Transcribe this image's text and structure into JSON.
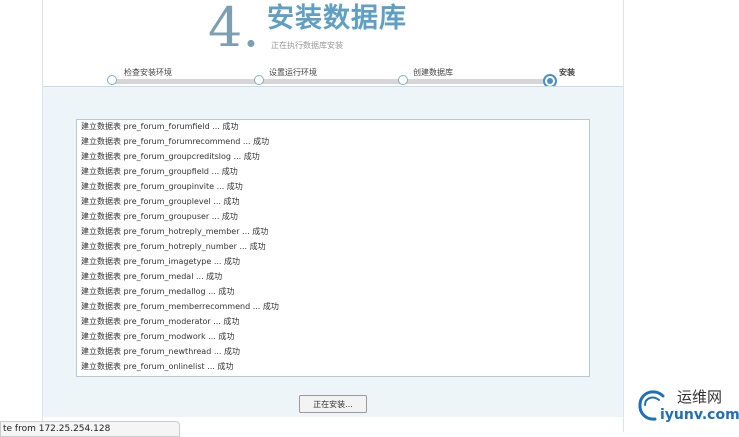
{
  "header": {
    "step_number": "4.",
    "title": "安装数据库",
    "subtitle": "正在执行数据库安装"
  },
  "steps": [
    {
      "label": "检查安装环境",
      "active": false
    },
    {
      "label": "设置运行环境",
      "active": false
    },
    {
      "label": "创建数据库",
      "active": false
    },
    {
      "label": "安装",
      "active": true
    }
  ],
  "log": {
    "lines": [
      "建立数据表 pre_forum_forumfield ... 成功",
      "建立数据表 pre_forum_forumrecommend ... 成功",
      "建立数据表 pre_forum_groupcreditslog ... 成功",
      "建立数据表 pre_forum_groupfield ... 成功",
      "建立数据表 pre_forum_groupinvite ... 成功",
      "建立数据表 pre_forum_grouplevel ... 成功",
      "建立数据表 pre_forum_groupuser ... 成功",
      "建立数据表 pre_forum_hotreply_member ... 成功",
      "建立数据表 pre_forum_hotreply_number ... 成功",
      "建立数据表 pre_forum_imagetype ... 成功",
      "建立数据表 pre_forum_medal ... 成功",
      "建立数据表 pre_forum_medallog ... 成功",
      "建立数据表 pre_forum_memberrecommend ... 成功",
      "建立数据表 pre_forum_moderator ... 成功",
      "建立数据表 pre_forum_modwork ... 成功",
      "建立数据表 pre_forum_newthread ... 成功",
      "建立数据表 pre_forum_onlinelist ... 成功"
    ]
  },
  "install_button": "正在安装...",
  "status_tooltip": "te from 172.25.254.128",
  "watermark": {
    "cn": "运维网",
    "en": "iyunv.com"
  },
  "colors": {
    "accent": "#5f9fc4",
    "step_dot": "#4a90c8"
  }
}
